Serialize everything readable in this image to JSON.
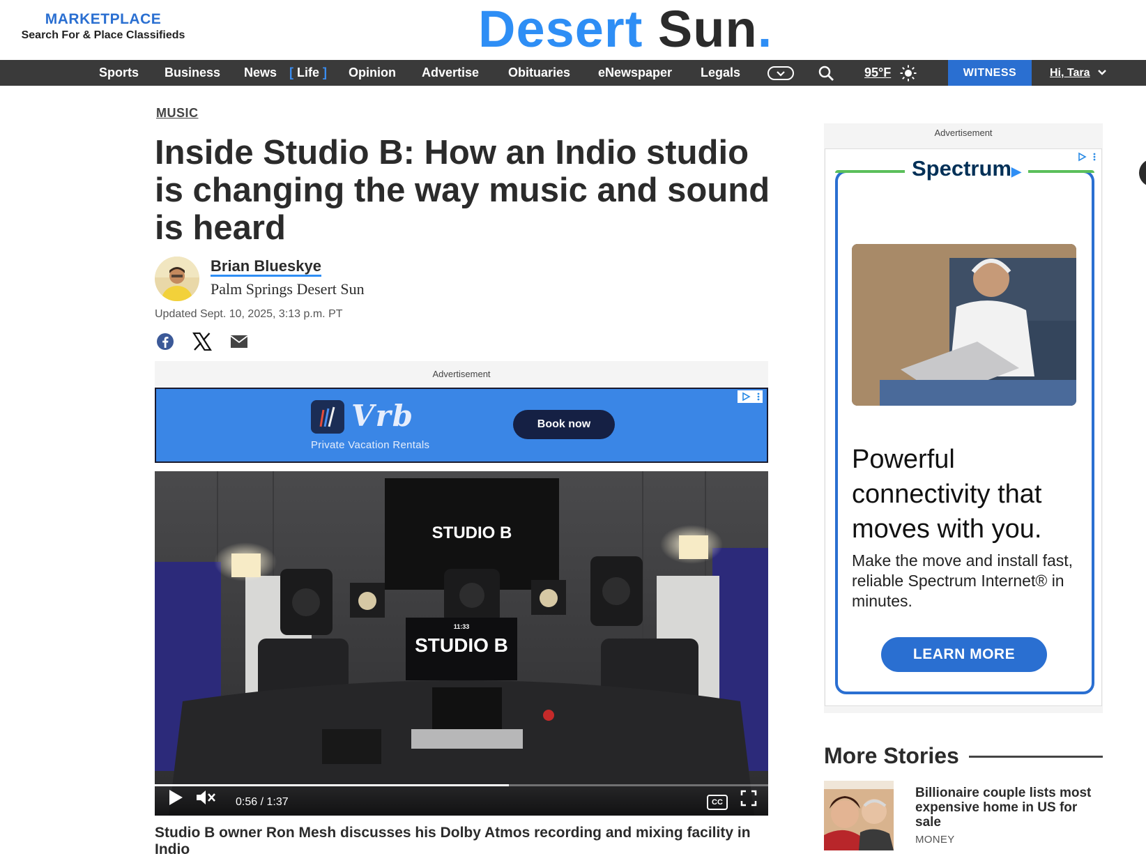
{
  "marketplace": {
    "title": "MARKETPLACE",
    "subtitle": "Search For & Place Classifieds"
  },
  "logo": {
    "word1": "Desert",
    "word2": "Sun",
    "dot": "."
  },
  "nav": {
    "items": [
      "Sports",
      "Business",
      "News",
      "Life",
      "Opinion",
      "Advertise",
      "Obituaries",
      "eNewspaper",
      "Legals"
    ],
    "active": "Life",
    "temperature": "95°F",
    "witness": "WITNESS",
    "user": "Hi, Tara"
  },
  "article": {
    "section": "MUSIC",
    "headline": "Inside Studio B: How an Indio studio is changing the way music and sound is heard",
    "author": "Brian Blueskye",
    "publication": "Palm Springs Desert Sun",
    "updated": "Updated Sept. 10, 2025, 3:13 p.m. PT",
    "share": [
      "facebook-icon",
      "x-icon",
      "email-icon"
    ]
  },
  "banner_ad": {
    "label": "Advertisement",
    "brand": "Vrb",
    "tagline": "Private Vacation Rentals",
    "cta": "Book now"
  },
  "video": {
    "screen_text": "STUDIO B",
    "monitor_text": "STUDIO B",
    "monitor_time": "11:33",
    "current_time": "0:56",
    "separator": "/",
    "duration": "1:37",
    "progress": 0.577,
    "cc_label": "CC",
    "caption": "Studio B owner Ron Mesh discusses his Dolby Atmos recording and mixing facility in Indio"
  },
  "side_ad": {
    "label": "Advertisement",
    "brand": "Spectrum",
    "headline": "Powerful connectivity that moves with you.",
    "sub": "Make the move and install fast, reliable Spectrum Internet® in minutes.",
    "cta": "LEARN MORE"
  },
  "more_stories": {
    "title": "More Stories",
    "items": [
      {
        "title": "Billionaire couple lists most expensive home in US for sale",
        "tag": "MONEY"
      }
    ]
  },
  "colors": {
    "accent": "#2e8ef5",
    "nav_bg": "#3a3a3a",
    "witness": "#2a6fd1",
    "banner": "#3a86e6"
  }
}
